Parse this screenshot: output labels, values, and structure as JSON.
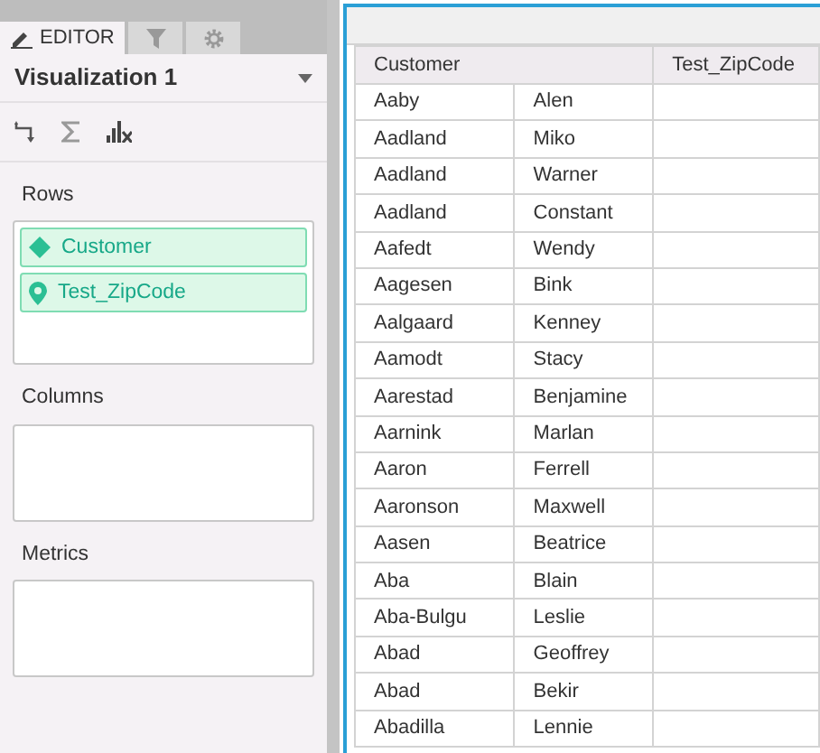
{
  "tabs": [
    {
      "kind": "editor",
      "label": "EDITOR",
      "selected": true
    },
    {
      "kind": "filter",
      "selected": false
    },
    {
      "kind": "settings",
      "selected": false
    }
  ],
  "visualization": {
    "title": "Visualization 1"
  },
  "sections": [
    {
      "label": "Rows",
      "items": [
        {
          "kind": "attribute",
          "label": "Customer"
        },
        {
          "kind": "geo",
          "label": "Test_ZipCode"
        }
      ]
    },
    {
      "label": "Columns"
    },
    {
      "label": "Metrics"
    }
  ],
  "table": {
    "columns": [
      {
        "label": "Customer",
        "colspan": 2
      },
      {
        "label": "Test_ZipCode"
      }
    ],
    "rows": [
      [
        "Aaby",
        "Alen"
      ],
      [
        "Aadland",
        "Miko"
      ],
      [
        "Aadland",
        "Warner"
      ],
      [
        "Aadland",
        "Constant"
      ],
      [
        "Aafedt",
        "Wendy"
      ],
      [
        "Aagesen",
        "Bink"
      ],
      [
        "Aalgaard",
        "Kenney"
      ],
      [
        "Aamodt",
        "Stacy"
      ],
      [
        "Aarestad",
        "Benjamine"
      ],
      [
        "Aarnink",
        "Marlan"
      ],
      [
        "Aaron",
        "Ferrell"
      ],
      [
        "Aaronson",
        "Maxwell"
      ],
      [
        "Aasen",
        "Beatrice"
      ],
      [
        "Aba",
        "Blain"
      ],
      [
        "Aba-Bulgu",
        "Leslie"
      ],
      [
        "Abad",
        "Geoffrey"
      ],
      [
        "Abad",
        "Bekir"
      ],
      [
        "Abadilla",
        "Lennie"
      ]
    ]
  }
}
